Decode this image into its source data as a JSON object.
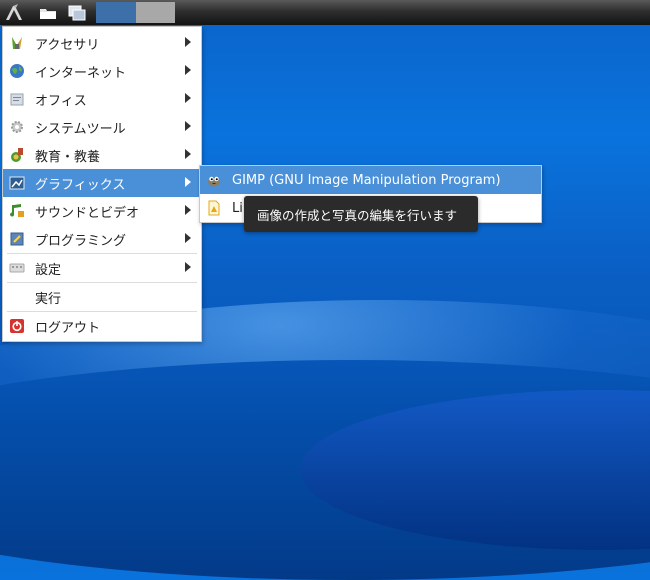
{
  "taskbar": {
    "start_icon": "lxde-logo-icon",
    "buttons": [
      "file-manager-icon",
      "show-desktop-icon"
    ]
  },
  "main_menu": {
    "items": [
      {
        "label": "アクセサリ",
        "icon": "accessories-icon"
      },
      {
        "label": "インターネット",
        "icon": "globe-icon"
      },
      {
        "label": "オフィス",
        "icon": "office-icon"
      },
      {
        "label": "システムツール",
        "icon": "system-tools-icon"
      },
      {
        "label": "教育・教養",
        "icon": "education-icon"
      },
      {
        "label": "グラフィックス",
        "icon": "graphics-icon"
      },
      {
        "label": "サウンドとビデオ",
        "icon": "multimedia-icon"
      },
      {
        "label": "プログラミング",
        "icon": "programming-icon"
      },
      {
        "label": "設定",
        "icon": "preferences-icon"
      },
      {
        "label": "実行",
        "icon": ""
      },
      {
        "label": "ログアウト",
        "icon": "logout-icon"
      }
    ]
  },
  "submenu": {
    "items": [
      {
        "label": "GIMP (GNU Image Manipulation Program)",
        "icon": "gimp-icon"
      },
      {
        "label": "Li",
        "icon": "libreoffice-draw-icon"
      }
    ]
  },
  "tooltip": {
    "text": "画像の作成と写真の編集を行います"
  },
  "colors": {
    "highlight": "#4a90d9",
    "desktop": "#0a6cd6",
    "tooltip_bg": "#2b2b2b"
  }
}
